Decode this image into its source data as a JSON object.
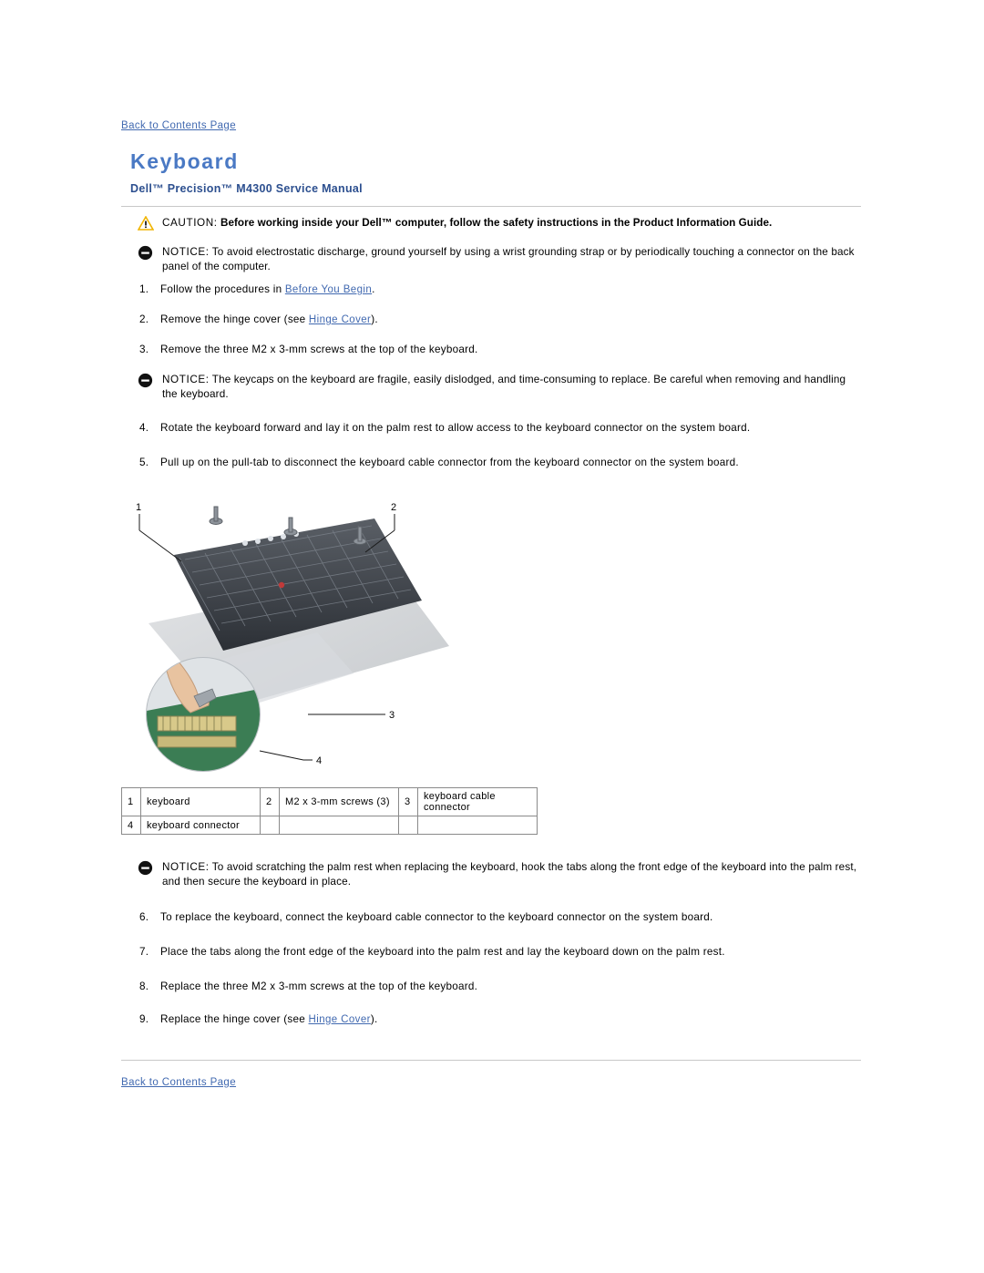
{
  "page": {
    "top_link": "Back to Contents Page",
    "bottom_link": "Back to Contents Page",
    "title": "Keyboard",
    "subtitle": "Dell™ Precision™ M4300  Service Manual"
  },
  "caution": {
    "lead": "CAUTION:",
    "text": " Before working inside your Dell™ computer, follow the safety instructions in the Product Information Guide."
  },
  "notices": [
    {
      "lead": "NOTICE:",
      "text": " To avoid electrostatic discharge, ground yourself by using a wrist grounding strap or by periodically touching a connector on the back panel of the computer."
    },
    {
      "lead": "NOTICE:",
      "text": " The keycaps on the keyboard are fragile, easily dislodged, and time-consuming to replace. Be careful when removing and handling the keyboard."
    },
    {
      "lead": "NOTICE:",
      "text": " To avoid scratching the palm rest when replacing the keyboard, hook the tabs along the front edge of the keyboard into the palm rest, and then secure the keyboard in place."
    }
  ],
  "steps_before": [
    {
      "num": "1.",
      "pre": "Follow the procedures in ",
      "link": "Before You Begin",
      "post": "."
    },
    {
      "num": "2.",
      "pre": "Remove the hinge cover (see ",
      "link": "Hinge Cover",
      "post": ")."
    },
    {
      "num": "3.",
      "pre": "Remove the three M2 x 3-mm screws at the top of the keyboard.",
      "link": "",
      "post": ""
    }
  ],
  "steps_middle": [
    {
      "num": "4.",
      "pre": "Rotate the keyboard forward and lay it on the palm rest to allow access to the keyboard connector on the system board.",
      "link": "",
      "post": ""
    },
    {
      "num": "5.",
      "pre": "Pull up on the pull-tab to disconnect the keyboard cable connector from the keyboard connector on the system board.",
      "link": "",
      "post": ""
    }
  ],
  "steps_after": [
    {
      "num": "6.",
      "pre": "To replace the keyboard, connect the keyboard cable connector to the keyboard connector on the system board.",
      "link": "",
      "post": ""
    },
    {
      "num": "7.",
      "pre": "Place the tabs along the front edge of the keyboard into the palm rest and lay the keyboard down on the palm rest.",
      "link": "",
      "post": ""
    },
    {
      "num": "8.",
      "pre": "Replace the three M2 x 3-mm screws at the top of the keyboard.",
      "link": "",
      "post": ""
    },
    {
      "num": "9.",
      "pre": "Replace the hinge cover (see ",
      "link": "Hinge Cover",
      "post": ")."
    }
  ],
  "legend": {
    "cells": [
      {
        "idx": "1",
        "label": "keyboard"
      },
      {
        "idx": "2",
        "label": "M2 x 3-mm screws (3)"
      },
      {
        "idx": "3",
        "label": "keyboard cable connector"
      },
      {
        "idx": "4",
        "label": "keyboard connector"
      }
    ]
  },
  "figure": {
    "callouts": [
      "1",
      "2",
      "3",
      "4"
    ],
    "alt": "Exploded view of laptop keyboard removal showing keyboard, three screws, keyboard cable connector and keyboard connector on the system board"
  },
  "colors": {
    "link": "#4169b0",
    "title": "#4a79c4",
    "subtitle": "#2c4f8f",
    "caution_icon": "#f5c518",
    "rule": "#c8c8c8"
  }
}
